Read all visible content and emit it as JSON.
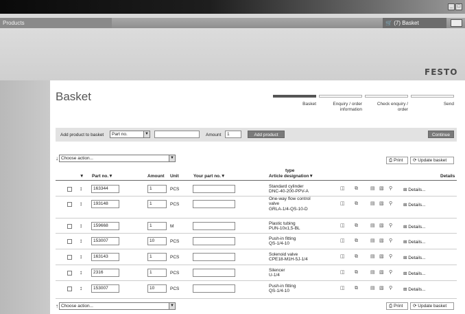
{
  "window": {
    "minimize": "_",
    "restore": "□"
  },
  "tabs": {
    "products": "Products",
    "basket": "(7) Basket",
    "basket_icon": "cart-icon"
  },
  "brand": {
    "logo": "FESTO"
  },
  "page": {
    "title": "Basket"
  },
  "steps": [
    {
      "label": "Basket",
      "active": true
    },
    {
      "label": "Enquiry / order information",
      "active": false
    },
    {
      "label": "Check enquiry / order",
      "active": false
    },
    {
      "label": "Send",
      "active": false
    }
  ],
  "add_bar": {
    "label": "Add product to basket",
    "type_select": "Part no.",
    "part_value": "",
    "amount_label": "Amount",
    "amount_value": "1",
    "add_button": "Add product",
    "continue_button": "Continue"
  },
  "actions": {
    "choose_action": "Choose action...",
    "print": "Print",
    "update": "Update basket"
  },
  "table": {
    "headers": {
      "part_no": "Part no.",
      "amount": "Amount",
      "unit": "Unit",
      "your_part_no": "Your part no.",
      "type_top": "type",
      "article": "Article designation",
      "details": "Details"
    },
    "details_link": "Details...",
    "rows": [
      {
        "part_no": "163344",
        "amount": "1",
        "unit": "PCS",
        "your_part": "",
        "desc": [
          "Standard cylinder",
          "DNC-40-200-PPV-A"
        ]
      },
      {
        "part_no": "193148",
        "amount": "1",
        "unit": "PCS",
        "your_part": "",
        "desc": [
          "One-way flow control",
          "valve",
          "GRLA-1/4-QS-10-D"
        ]
      },
      {
        "part_no": "159668",
        "amount": "1",
        "unit": "M",
        "your_part": "",
        "desc": [
          "Plastic tubing",
          "PUN-10x1,5-BL"
        ]
      },
      {
        "part_no": "153007",
        "amount": "10",
        "unit": "PCS",
        "your_part": "",
        "desc": [
          "Push-in fitting",
          "QS-1/4-10"
        ]
      },
      {
        "part_no": "163143",
        "amount": "1",
        "unit": "PCS",
        "your_part": "",
        "desc": [
          "Solenoid valve",
          "CPE18-M1H-5J-1/4"
        ]
      },
      {
        "part_no": "2316",
        "amount": "1",
        "unit": "PCS",
        "your_part": "",
        "desc": [
          "Silencer",
          "U-1/4"
        ]
      },
      {
        "part_no": "153007",
        "amount": "10",
        "unit": "PCS",
        "your_part": "",
        "desc": [
          "Push-in fitting",
          "QS-1/4-10"
        ]
      }
    ]
  }
}
